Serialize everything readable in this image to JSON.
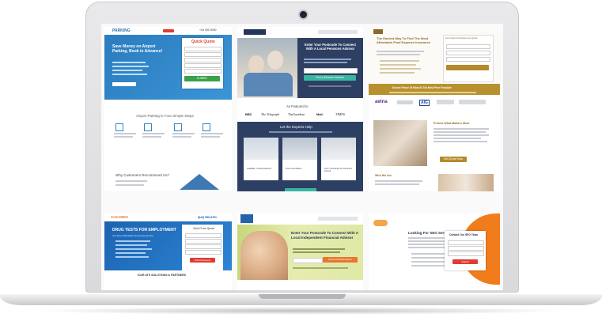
{
  "card1": {
    "logo": "PARKING",
    "headline": "Save Money on Airport Parking, Book in Advance!",
    "quote_title": "Quick Quote",
    "phone": "+44 000 0000",
    "book_button": "SUBMIT",
    "steps_title": "Airport Parking in Four Simple Steps",
    "steps_highlight": "Four Simple Steps",
    "why_title": "Why Customers Recommend Us?",
    "colors": {
      "primary": "#2f84c6",
      "accent": "#e23b33"
    }
  },
  "card2": {
    "form_title": "Enter Your Postcode To Connect With A Local Pensions Advisor",
    "cta": "Find a Pension Advisor",
    "featured": "As Featured In",
    "press": [
      "BBC",
      "The Telegraph",
      "TheGuardian",
      "Mail",
      "TIMES"
    ],
    "experts_title": "Let the Experts Help",
    "icons": [
      "Available, Trusted Advisors",
      "Free Consultation",
      "Over Thousands of Customers Served"
    ]
  },
  "card3": {
    "headline": "The Easiest Way To Find The Most Affordable Final Expense Insurance",
    "get_quote": "Get Instant Final Expense Quote",
    "peace_title": "Secure Peace Of Mind At The Best Price Possible",
    "brands": [
      "aetna",
      "AIG"
    ],
    "protect_title": "Protect What Matters Most",
    "quote_button": "Get Quote Now",
    "who_title": "Who We Are"
  },
  "card4": {
    "logo": "CLEARED",
    "phone": "(844) 559-5751",
    "headline": "DRUG TESTS FOR EMPLOYMENT",
    "sub": "Get Easy Affordable Screening Service",
    "form_title": "Get A Free Quote",
    "submit": "Submit Request",
    "footer": "ICUR ATS SOLUTIONS & PARTNERS"
  },
  "card5": {
    "headline": "Enter Your Postcode To Connect With A Local Independent Financial Advisor",
    "cta": "Find a Financial Advisor"
  },
  "card6": {
    "headline": "Looking For SEO Services?",
    "box_title": "Contact Our SEO Team",
    "submit": "Submit"
  }
}
